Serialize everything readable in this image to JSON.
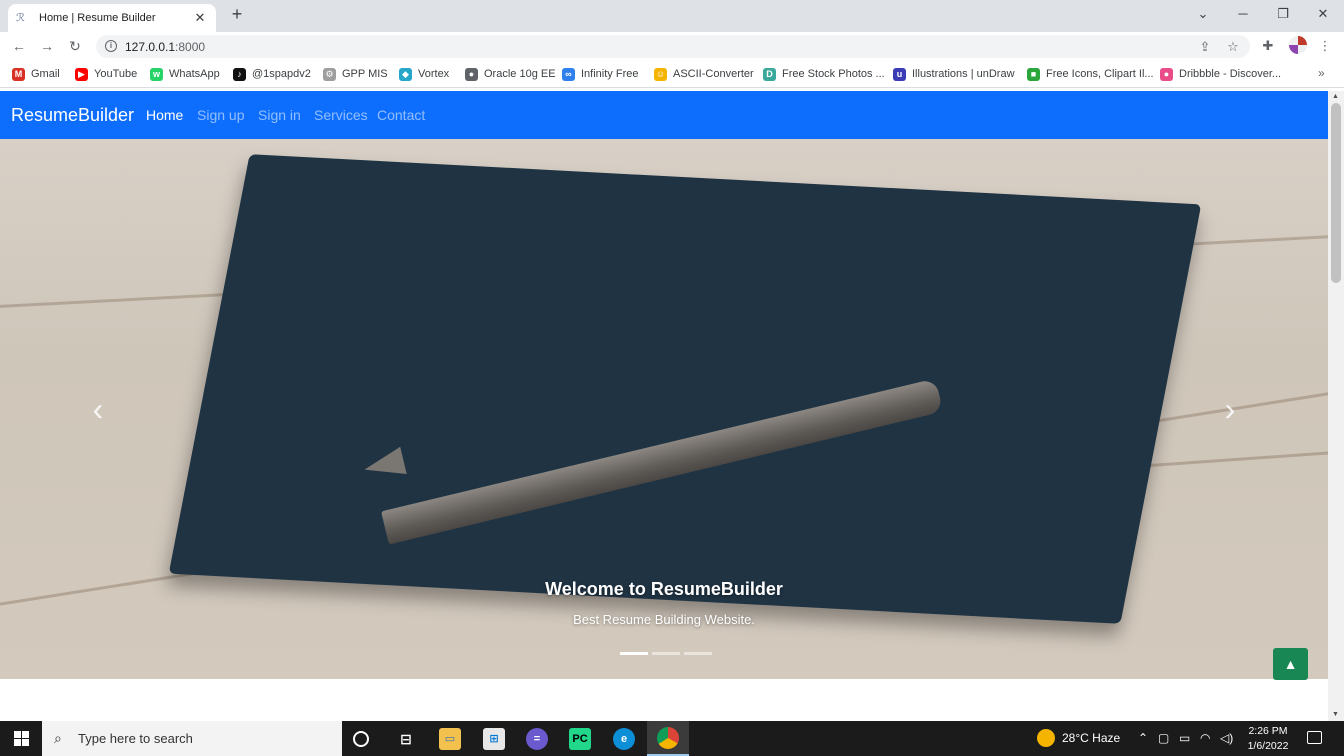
{
  "browser": {
    "tab_title": "Home | Resume Builder",
    "tab_close": "✕",
    "new_tab": "+",
    "url_host": "127.0.0.1",
    "url_port": ":8000",
    "bookmarks": [
      {
        "label": "Gmail",
        "icon": "gmail-icon",
        "color": "#d93025",
        "glyph": "M"
      },
      {
        "label": "YouTube",
        "icon": "youtube-icon",
        "color": "#ff0000",
        "glyph": "▶"
      },
      {
        "label": "WhatsApp",
        "icon": "whatsapp-icon",
        "color": "#25d366",
        "glyph": "w"
      },
      {
        "label": "@1spapdv2",
        "icon": "tiktok-icon",
        "color": "#111111",
        "glyph": "♪"
      },
      {
        "label": "GPP MIS",
        "icon": "gpp-icon",
        "color": "#9e9e9e",
        "glyph": "⚙"
      },
      {
        "label": "Vortex",
        "icon": "vortex-icon",
        "color": "#26a6c9",
        "glyph": "◆"
      },
      {
        "label": "Oracle 10g EE",
        "icon": "globe-icon",
        "color": "#5f6368",
        "glyph": "●"
      },
      {
        "label": "Infinity Free",
        "icon": "infinity-icon",
        "color": "#2f80ed",
        "glyph": "∞"
      },
      {
        "label": "ASCII-Converter",
        "icon": "ascii-icon",
        "color": "#f4b400",
        "glyph": "☺"
      },
      {
        "label": "Free Stock Photos ...",
        "icon": "stock-photos-icon",
        "color": "#3aa89a",
        "glyph": "D"
      },
      {
        "label": "Illustrations | unDraw",
        "icon": "undraw-icon",
        "color": "#3b3bb5",
        "glyph": "u"
      },
      {
        "label": "Free Icons, Clipart Il...",
        "icon": "free-icons-icon",
        "color": "#2aa63a",
        "glyph": "■"
      },
      {
        "label": "Dribbble - Discover...",
        "icon": "dribbble-icon",
        "color": "#ea4c89",
        "glyph": "●"
      }
    ],
    "bookmarks_more": "»"
  },
  "site": {
    "brand": "ResumeBuilder",
    "nav": [
      {
        "label": "Home",
        "active": true
      },
      {
        "label": "Sign up",
        "active": false
      },
      {
        "label": "Sign in",
        "active": false
      },
      {
        "label": "Services",
        "active": false
      },
      {
        "label": "Contact",
        "active": false
      }
    ],
    "carousel": {
      "title": "Welcome to ResumeBuilder",
      "subtitle": "Best Resume Building Website.",
      "prev": "‹",
      "next": "›",
      "slide_count": 3,
      "active_slide": 1
    },
    "back_to_top": "▲"
  },
  "taskbar": {
    "search_placeholder": "Type here to search",
    "weather": "28°C  Haze",
    "time": "2:26 PM",
    "date": "1/6/2022"
  },
  "colors": {
    "navbar": "#0d6efd",
    "back_to_top": "#198754"
  }
}
